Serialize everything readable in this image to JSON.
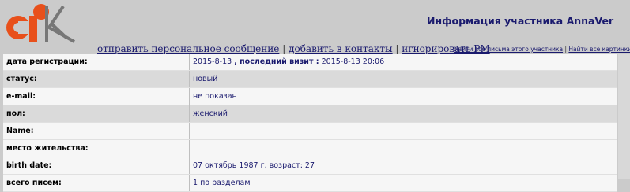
{
  "header": {
    "title": "Информация участника AnnaVer"
  },
  "actions": {
    "send_pm": "отправить персональное сообщение",
    "add_contacts": "добавить в контакты",
    "ignore_pm": "игнорировать PM",
    "separator": "|"
  },
  "search": {
    "all_letters": "Найти все письма этого участника",
    "all_pictures": "Найти все картинки",
    "separator": "|"
  },
  "profile": {
    "reg_label": "дата регистрации:",
    "reg_date": "2015-8-13",
    "last_visit_label": ", последний визит :",
    "last_visit": "2015-8-13 20:06",
    "status_label": "статус:",
    "status_value": "новый",
    "email_label": "e-mail:",
    "email_value": "не показан",
    "gender_label": "пол:",
    "gender_value": "женский",
    "name_label": "Name:",
    "name_value": "",
    "residence_label": "место жительства:",
    "residence_value": "",
    "birth_label": "birth date:",
    "birth_value": "07 октябрь 1987 г. возраст: 27",
    "letters_label": "всего писем:",
    "letters_count": "1",
    "letters_link": "по разделам"
  },
  "colors": {
    "logo_orange": "#e8501b",
    "logo_gray": "#777777",
    "link": "#1a1a6e"
  }
}
